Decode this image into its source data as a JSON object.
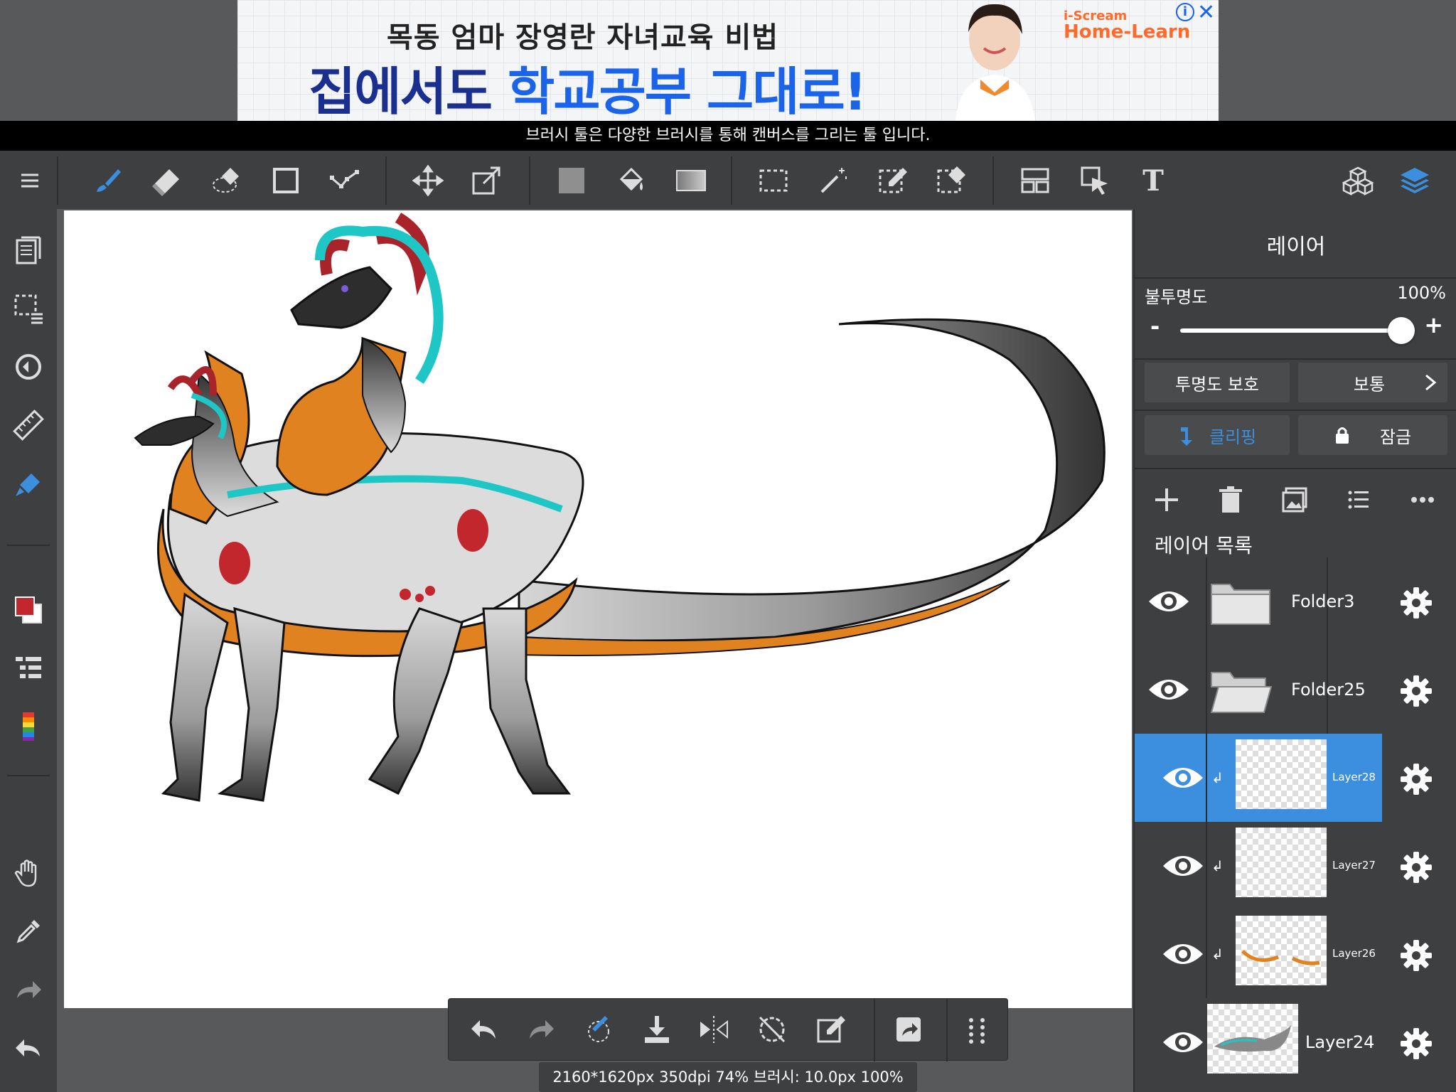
{
  "ad": {
    "line1": "목동 엄마 장영란 자녀교육 비법",
    "line2_a": "집에서도 ",
    "line2_b": "학교공부 그대로!",
    "brand_small": "i-Scream",
    "brand_large": "Home-Learn",
    "info": "i",
    "close": "✕"
  },
  "hint": "브러시 툴은 다양한 브러시를 통해 캔버스를 그리는 툴 입니다.",
  "toolbar": {
    "text_tool": "T"
  },
  "colors": {
    "accent": "#3c8fde",
    "bg": "#3e3f41",
    "primary_color": "#c1272d",
    "secondary_color": "#ffffff"
  },
  "status": "2160*1620px 350dpi 74% 브러시: 10.0px 100%",
  "panel": {
    "title": "레이어",
    "opacity_label": "불투명도",
    "opacity_value": "100%",
    "opacity_fraction": 1.0,
    "minus": "-",
    "plus": "+",
    "protect_alpha": "투명도 보호",
    "blend_mode": "보통",
    "clipping": "클리핑",
    "lock": "잠금",
    "list_title": "레이어 목록",
    "layers": [
      {
        "name": "Folder3",
        "type": "folder"
      },
      {
        "name": "Folder25",
        "type": "folder"
      },
      {
        "name": "Layer28",
        "type": "layer",
        "selected": true,
        "clipped": true
      },
      {
        "name": "Layer27",
        "type": "layer",
        "clipped": true
      },
      {
        "name": "Layer26",
        "type": "layer",
        "clipped": true
      },
      {
        "name": "Layer24",
        "type": "layer"
      }
    ]
  }
}
